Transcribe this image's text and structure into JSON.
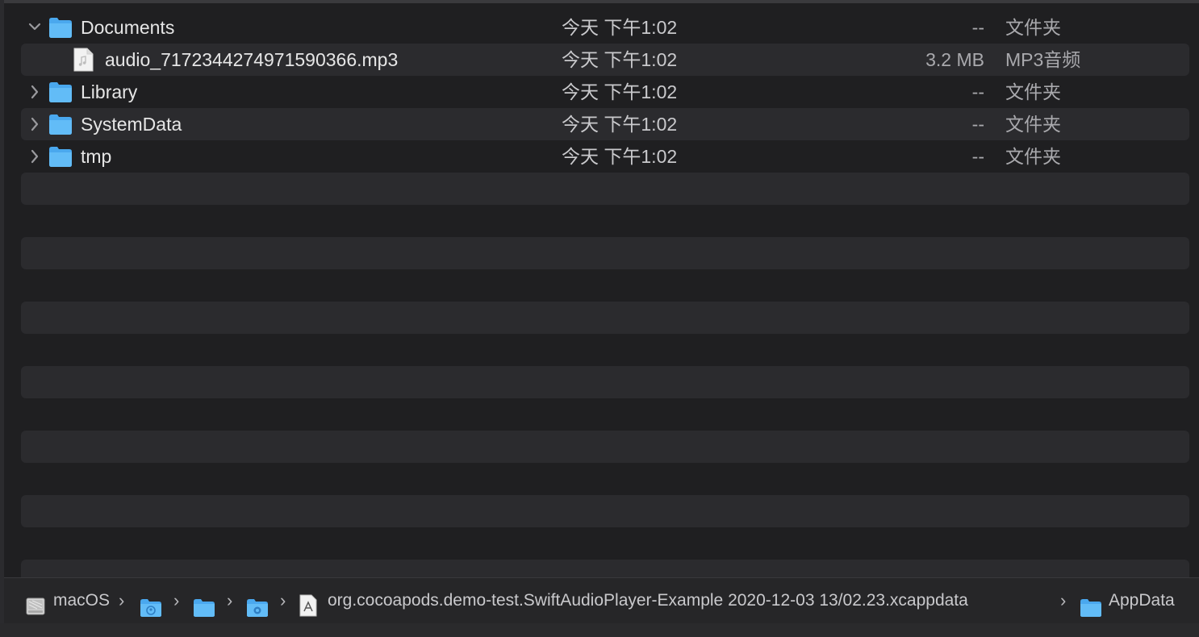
{
  "files": [
    {
      "name": "Documents",
      "date": "今天 下午1:02",
      "size": "--",
      "kind": "文件夹",
      "type": "folder",
      "expanded": true
    },
    {
      "name": "audio_7172344274971590366.mp3",
      "date": "今天 下午1:02",
      "size": "3.2 MB",
      "kind": "MP3音频",
      "type": "file"
    },
    {
      "name": "Library",
      "date": "今天 下午1:02",
      "size": "--",
      "kind": "文件夹",
      "type": "folder",
      "expanded": false
    },
    {
      "name": "SystemData",
      "date": "今天 下午1:02",
      "size": "--",
      "kind": "文件夹",
      "type": "folder",
      "expanded": false
    },
    {
      "name": "tmp",
      "date": "今天 下午1:02",
      "size": "--",
      "kind": "文件夹",
      "type": "folder",
      "expanded": false
    }
  ],
  "pathbar": {
    "items": [
      {
        "label": "macOS",
        "icon": "hard-drive-icon"
      },
      {
        "label": "",
        "icon": "home-folder-icon"
      },
      {
        "label": "",
        "icon": "folder-icon"
      },
      {
        "label": "",
        "icon": "system-folder-icon"
      },
      {
        "label": "org.cocoapods.demo-test.SwiftAudioPlayer-Example 2020-12-03 13/02.23.xcappdata",
        "icon": "app-document-icon"
      },
      {
        "label": "AppData",
        "icon": "folder-icon"
      }
    ]
  },
  "colors": {
    "folder": "#5bb6f5",
    "stripe": "#2b2b2e",
    "background": "#1f1f21"
  }
}
